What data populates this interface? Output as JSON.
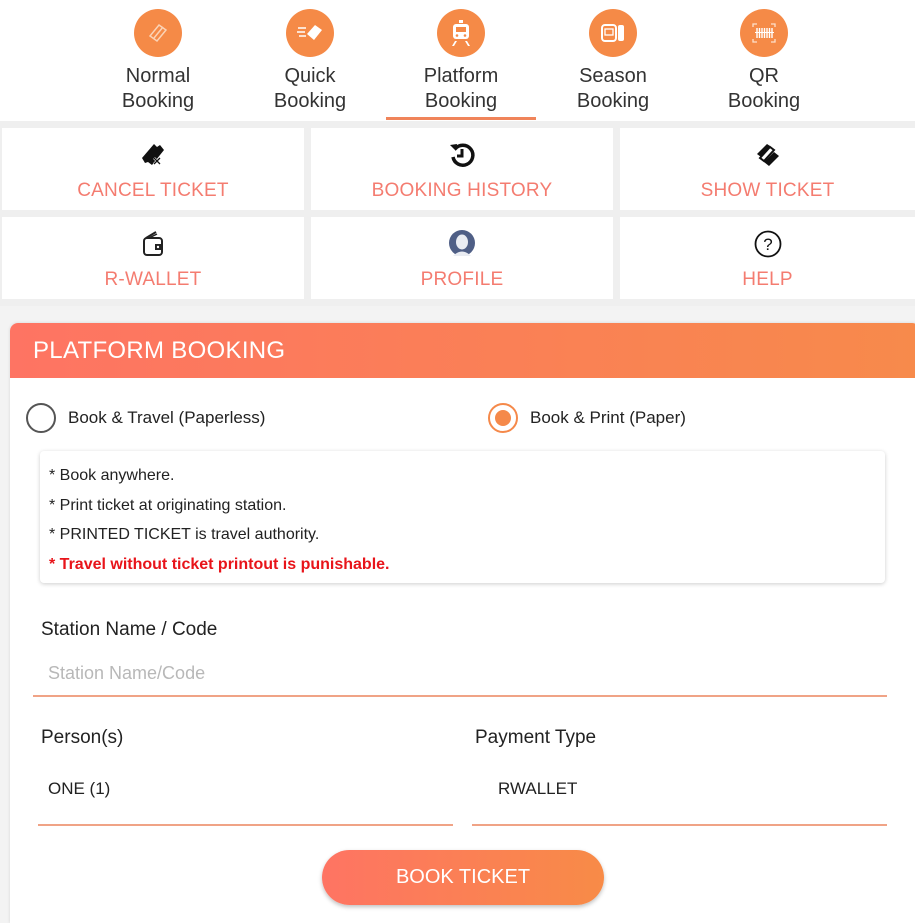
{
  "colors": {
    "accent": "#f58a47",
    "tile_label": "#f47c70",
    "warning": "#e8141a"
  },
  "top_tabs": [
    {
      "label": "Normal\nBooking",
      "line1": "Normal",
      "line2": "Booking",
      "icon": "ticket-icon",
      "active": false
    },
    {
      "label": "Quick Booking",
      "line1": "Quick",
      "line2": "Booking",
      "icon": "fast-ticket-icon",
      "active": false
    },
    {
      "label": "Platform Booking",
      "line1": "Platform",
      "line2": "Booking",
      "icon": "train-icon",
      "active": true
    },
    {
      "label": "Season Booking",
      "line1": "Season",
      "line2": "Booking",
      "icon": "season-ticket-icon",
      "active": false
    },
    {
      "label": "QR Booking",
      "line1": "QR",
      "line2": "Booking",
      "icon": "qr-scan-icon",
      "active": false
    }
  ],
  "tiles": [
    {
      "label": "CANCEL TICKET",
      "icon": "cancel-ticket-icon"
    },
    {
      "label": "BOOKING HISTORY",
      "icon": "history-icon"
    },
    {
      "label": "SHOW TICKET",
      "icon": "tickets-icon"
    },
    {
      "label": "R-WALLET",
      "icon": "wallet-icon"
    },
    {
      "label": "PROFILE",
      "icon": "profile-icon"
    },
    {
      "label": "HELP",
      "icon": "help-icon"
    }
  ],
  "form": {
    "title": "PLATFORM BOOKING",
    "radio_options": [
      {
        "label": "Book & Travel (Paperless)",
        "selected": false
      },
      {
        "label": "Book & Print (Paper)",
        "selected": true
      }
    ],
    "notes": [
      "* Book anywhere.",
      "* Print ticket at originating station.",
      "* PRINTED TICKET is travel authority.",
      "* Travel without ticket printout is punishable."
    ],
    "station_label": "Station Name / Code",
    "station_placeholder": "Station Name/Code",
    "station_value": "",
    "persons_label": "Person(s)",
    "persons_value": "ONE (1)",
    "payment_label": "Payment Type",
    "payment_value": "RWALLET",
    "submit_label": "BOOK TICKET"
  }
}
